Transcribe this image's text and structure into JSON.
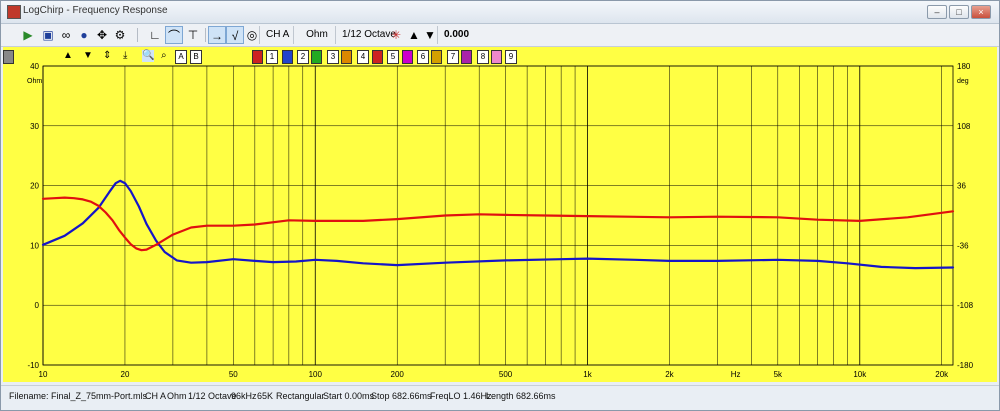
{
  "window": {
    "title": "LogChirp - Frequency Response"
  },
  "toolbar": {
    "channel": "CH A",
    "unit": "Ohm",
    "smoothing": "1/12 Octave",
    "value": "0.000",
    "icons": [
      "play-icon",
      "save-icon",
      "loop-icon",
      "mic-icon",
      "arrows-icon",
      "gear-icon",
      "axis-icon",
      "curve-icon",
      "phase-icon",
      "marker-icon",
      "slope-icon",
      "target-icon",
      "star-icon",
      "arrow-up-icon",
      "arrow-down-icon"
    ]
  },
  "trace_toolbar": {
    "labels": [
      "A",
      "B",
      "1",
      "2",
      "3",
      "4",
      "5",
      "6",
      "7",
      "8",
      "9"
    ],
    "colors": [
      "#cc2222",
      "#2244cc",
      "#22aa22",
      "#dd8800",
      "#cc2222",
      "#cc00cc",
      "#d4a000",
      "#aa22aa",
      "#ee88cc",
      "#888888"
    ]
  },
  "chart_data": {
    "type": "line",
    "xscale": "log",
    "xlim": [
      10,
      22000
    ],
    "ylim_left": [
      -10,
      40
    ],
    "ylim_right": [
      -180,
      180
    ],
    "ylabel_left": "Ohm",
    "ylabel_right": "deg",
    "xunit": "Hz",
    "x_tick_labels": [
      {
        "v": 10,
        "t": "10"
      },
      {
        "v": 20,
        "t": "20"
      },
      {
        "v": 50,
        "t": "50"
      },
      {
        "v": 100,
        "t": "100"
      },
      {
        "v": 200,
        "t": "200"
      },
      {
        "v": 500,
        "t": "500"
      },
      {
        "v": 1000,
        "t": "1k"
      },
      {
        "v": 2000,
        "t": "2k"
      },
      {
        "v": 5000,
        "t": "5k"
      },
      {
        "v": 10000,
        "t": "10k"
      },
      {
        "v": 20000,
        "t": "20k"
      }
    ],
    "hz_label_at": 3500,
    "y_left_ticks": [
      "-10",
      "0",
      "10",
      "20",
      "30",
      "40"
    ],
    "y_right_ticks": [
      "-180",
      "-108",
      "-36",
      "36",
      "108",
      "180"
    ],
    "grid": true,
    "series": [
      {
        "color": "#1515c8",
        "axis": "left",
        "points": [
          [
            10,
            10.1
          ],
          [
            12,
            11.6
          ],
          [
            14,
            13.7
          ],
          [
            16,
            16.3
          ],
          [
            17.5,
            18.9
          ],
          [
            18.5,
            20.4
          ],
          [
            19.2,
            20.8
          ],
          [
            20,
            20.4
          ],
          [
            21,
            19.1
          ],
          [
            22.5,
            16.5
          ],
          [
            24,
            13.6
          ],
          [
            26,
            10.8
          ],
          [
            28,
            8.9
          ],
          [
            31,
            7.5
          ],
          [
            35,
            7.1
          ],
          [
            40,
            7.2
          ],
          [
            50,
            7.7
          ],
          [
            60,
            7.4
          ],
          [
            70,
            7.2
          ],
          [
            85,
            7.3
          ],
          [
            100,
            7.6
          ],
          [
            120,
            7.4
          ],
          [
            150,
            7.0
          ],
          [
            200,
            6.7
          ],
          [
            300,
            7.1
          ],
          [
            500,
            7.5
          ],
          [
            800,
            7.7
          ],
          [
            1000,
            7.8
          ],
          [
            1500,
            7.6
          ],
          [
            2000,
            7.4
          ],
          [
            3000,
            7.4
          ],
          [
            5000,
            7.6
          ],
          [
            7000,
            7.4
          ],
          [
            9000,
            7.0
          ],
          [
            12000,
            6.4
          ],
          [
            16000,
            6.2
          ],
          [
            22000,
            6.3
          ]
        ]
      },
      {
        "color": "#e01010",
        "axis": "left",
        "points": [
          [
            10,
            17.8
          ],
          [
            11,
            17.9
          ],
          [
            12,
            18.0
          ],
          [
            13,
            17.9
          ],
          [
            14,
            17.7
          ],
          [
            15,
            17.3
          ],
          [
            16,
            16.6
          ],
          [
            17,
            15.5
          ],
          [
            18,
            14.2
          ],
          [
            19,
            12.6
          ],
          [
            20,
            11.3
          ],
          [
            21,
            10.2
          ],
          [
            22,
            9.5
          ],
          [
            23,
            9.2
          ],
          [
            24,
            9.3
          ],
          [
            26,
            10.1
          ],
          [
            30,
            11.8
          ],
          [
            35,
            13.0
          ],
          [
            40,
            13.3
          ],
          [
            50,
            13.3
          ],
          [
            60,
            13.5
          ],
          [
            80,
            14.2
          ],
          [
            100,
            14.1
          ],
          [
            150,
            14.1
          ],
          [
            200,
            14.4
          ],
          [
            300,
            15.0
          ],
          [
            400,
            15.2
          ],
          [
            500,
            15.1
          ],
          [
            700,
            15.0
          ],
          [
            1000,
            14.9
          ],
          [
            2000,
            14.7
          ],
          [
            3000,
            14.8
          ],
          [
            5000,
            14.7
          ],
          [
            7000,
            14.3
          ],
          [
            10000,
            14.1
          ],
          [
            15000,
            14.7
          ],
          [
            22000,
            15.7
          ]
        ]
      }
    ]
  },
  "status": {
    "filename": "Filename: Final_Z_75mm-Port.mls",
    "channel": "CH A",
    "unit": "Ohm",
    "smoothing": "1/12 Octave",
    "rate": "96kHz",
    "size": "65K",
    "window": "Rectangular",
    "start": "Start 0.00ms",
    "stop": "Stop 682.66ms",
    "freqlo": "FreqLO 1.46Hz",
    "length": "Length 682.66ms"
  }
}
